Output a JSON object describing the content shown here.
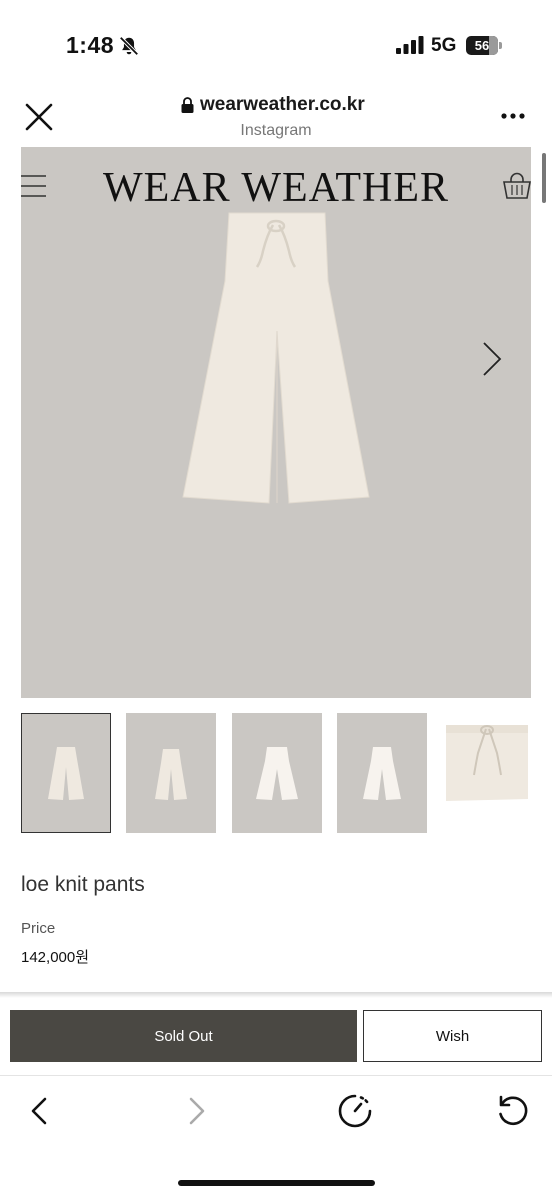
{
  "status_bar": {
    "time": "1:48",
    "network": "5G",
    "battery_level": "56",
    "icons": [
      "bell-slash-icon",
      "signal-bars-icon",
      "battery-icon"
    ]
  },
  "browser_header": {
    "domain": "wearweather.co.kr",
    "source": "Instagram",
    "icons": [
      "close-icon",
      "lock-icon",
      "more-icon"
    ]
  },
  "site": {
    "logo": "WEAR WEATHER",
    "icons": [
      "hamburger-menu-icon",
      "shopping-bag-icon",
      "chevron-right-icon"
    ],
    "colors": {
      "hero_background": "#cac7c3",
      "product_fabric": "#efe9e0"
    }
  },
  "gallery": {
    "selected_index": 0,
    "thumbnail_count": 5
  },
  "product": {
    "name": "loe knit pants",
    "price_label": "Price",
    "price": "142,000원"
  },
  "actions": {
    "sold_out_label": "Sold Out",
    "wish_label": "Wish",
    "colors": {
      "sold_out_bg": "#4a4843"
    }
  },
  "browser_toolbar": {
    "icons": [
      "back-icon",
      "forward-icon",
      "speed-icon",
      "reload-icon"
    ]
  }
}
